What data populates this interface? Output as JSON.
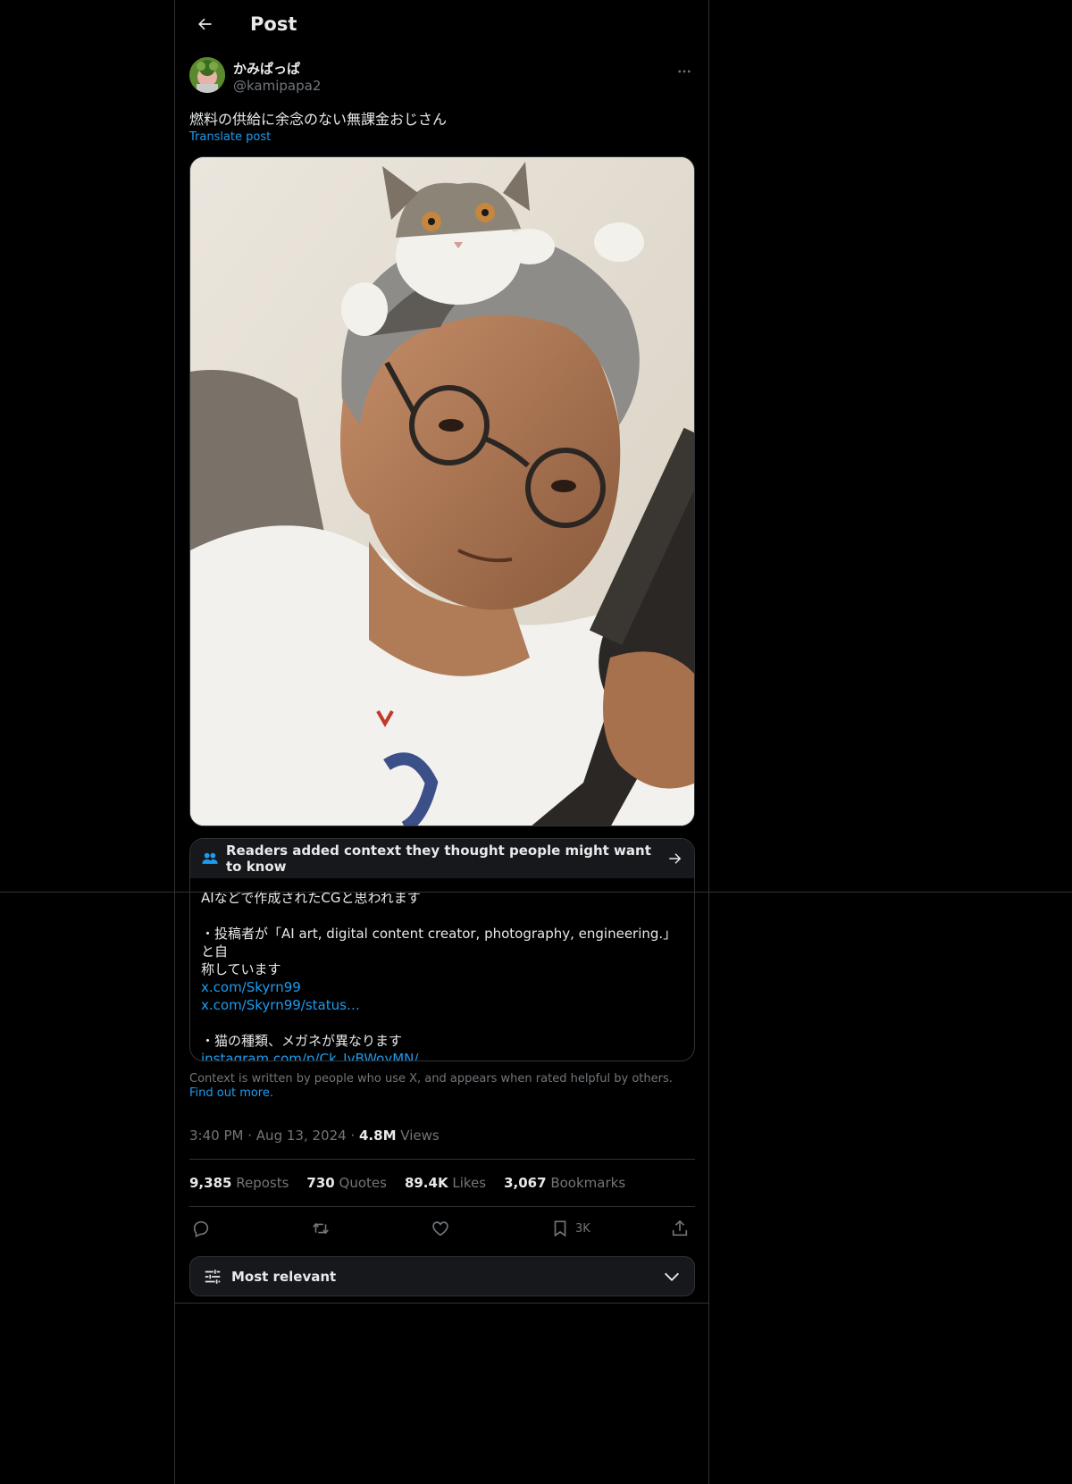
{
  "header": {
    "title": "Post",
    "back_icon": "arrow-left-icon"
  },
  "author": {
    "display_name": "かみぱっぱ",
    "handle": "@kamipapa2",
    "more_icon": "more-horizontal-icon"
  },
  "post": {
    "text": "燃料の供給に余念のない無課金おじさん",
    "translate_label": "Translate post"
  },
  "community_note": {
    "header": "Readers added context they thought people might want to know",
    "header_icon": "people-icon",
    "arrow_icon": "arrow-right-icon",
    "lines": [
      "AIなどで作成されたCGと思われます",
      "",
      "・投稿者が「AI art, digital content creator, photography, engineering.」と自",
      "称しています"
    ],
    "links": [
      "x.com/Skyrn99",
      "x.com/Skyrn99/status…"
    ],
    "line_after_links": "・猫の種類、メガネが異なります",
    "link_last": "instagram.com/p/Ck_JvBWoyMN/…",
    "footer_text": "Context is written by people who use X, and appears when rated helpful by others.",
    "footer_link": "Find out more."
  },
  "meta": {
    "time": "3:40 PM",
    "separator": "·",
    "date": "Aug 13, 2024",
    "views_count": "4.8M",
    "views_label": "Views"
  },
  "stats": {
    "reposts_count": "9,385",
    "reposts_label": "Reposts",
    "quotes_count": "730",
    "quotes_label": "Quotes",
    "likes_count": "89.4K",
    "likes_label": "Likes",
    "bookmarks_count": "3,067",
    "bookmarks_label": "Bookmarks"
  },
  "actions": {
    "reply_icon": "reply-icon",
    "repost_icon": "repost-icon",
    "like_icon": "heart-icon",
    "bookmark_icon": "bookmark-icon",
    "bookmark_count": "3K",
    "share_icon": "share-icon"
  },
  "sort": {
    "label": "Most relevant",
    "icon": "sliders-icon",
    "chevron_icon": "chevron-down-icon"
  },
  "colors": {
    "background": "#000000",
    "text_primary": "#e7e9ea",
    "text_secondary": "#71767b",
    "accent": "#1d9bf0",
    "border": "#2f3336",
    "note_header_bg": "#16181c"
  }
}
